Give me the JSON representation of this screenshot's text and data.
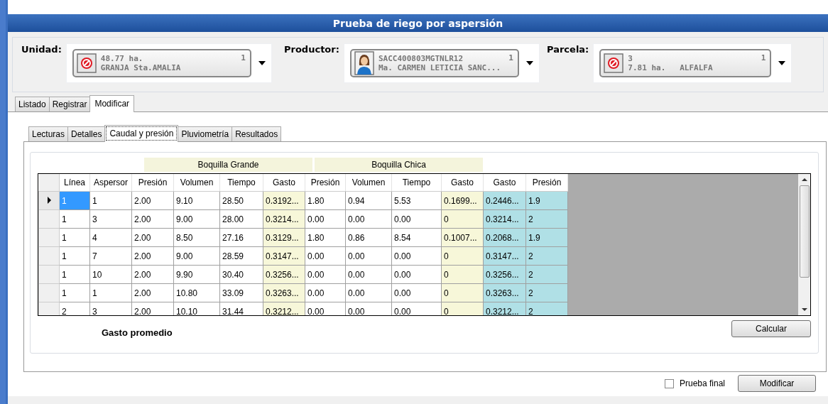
{
  "window": {
    "title": "Prueba de riego por aspersión"
  },
  "selectors": [
    {
      "label": "Unidad:",
      "kind": "blocked",
      "line1": "48.77 ha.",
      "line2": "GRANJA Sta.AMALIA",
      "count": "1"
    },
    {
      "label": "Productor:",
      "kind": "person",
      "line1": "SACC400803MGTNLR12",
      "line2": "Ma. CARMEN LETICIA SANC...",
      "count": "1"
    },
    {
      "label": "Parcela:",
      "kind": "blocked",
      "line1": "3",
      "line2": "7.81 ha.   ALFALFA",
      "count": "1"
    }
  ],
  "tabs": [
    {
      "label": "Listado",
      "selected": false
    },
    {
      "label": "Registrar",
      "selected": false
    },
    {
      "label": "Modificar",
      "selected": true
    }
  ],
  "subtabs": [
    {
      "label": "Lecturas",
      "selected": false
    },
    {
      "label": "Detalles",
      "selected": false
    },
    {
      "label": "Caudal y presión",
      "selected": true
    },
    {
      "label": "Pluviometría",
      "selected": false
    },
    {
      "label": "Resultados",
      "selected": false
    }
  ],
  "groups": [
    "Boquilla Grande",
    "Boquilla Chica"
  ],
  "table": {
    "columns": [
      {
        "label": "Línea",
        "kind": "plain"
      },
      {
        "label": "Aspersor",
        "kind": "plain"
      },
      {
        "label": "Presión",
        "kind": "plain"
      },
      {
        "label": "Volumen",
        "kind": "plain"
      },
      {
        "label": "Tiempo",
        "kind": "plain"
      },
      {
        "label": "Gasto",
        "kind": "yellow"
      },
      {
        "label": "Presión",
        "kind": "plain"
      },
      {
        "label": "Volumen",
        "kind": "plain"
      },
      {
        "label": "Tiempo",
        "kind": "plain"
      },
      {
        "label": "Gasto",
        "kind": "yellow"
      },
      {
        "label": "Gasto",
        "kind": "cyan"
      },
      {
        "label": "Presión",
        "kind": "cyan"
      }
    ],
    "rows": [
      {
        "selected": true,
        "cells": [
          "1",
          "1",
          "2.00",
          "9.10",
          "28.50",
          "0.3192...",
          "1.80",
          "0.94",
          "5.53",
          "0.1699...",
          "0.2446...",
          "1.9"
        ]
      },
      {
        "selected": false,
        "cells": [
          "1",
          "3",
          "2.00",
          "9.00",
          "28.00",
          "0.3214...",
          "0.00",
          "0.00",
          "0.00",
          "0",
          "0.3214...",
          "2"
        ]
      },
      {
        "selected": false,
        "cells": [
          "1",
          "4",
          "2.00",
          "8.50",
          "27.16",
          "0.3129...",
          "1.80",
          "0.86",
          "8.54",
          "0.1007...",
          "0.2068...",
          "1.9"
        ]
      },
      {
        "selected": false,
        "cells": [
          "1",
          "7",
          "2.00",
          "9.00",
          "28.59",
          "0.3147...",
          "0.00",
          "0.00",
          "0.00",
          "0",
          "0.3147...",
          "2"
        ]
      },
      {
        "selected": false,
        "cells": [
          "1",
          "10",
          "2.00",
          "9.90",
          "30.40",
          "0.3256...",
          "0.00",
          "0.00",
          "0.00",
          "0",
          "0.3256...",
          "2"
        ]
      },
      {
        "selected": false,
        "cells": [
          "1",
          "1",
          "2.00",
          "10.80",
          "33.09",
          "0.3263...",
          "0.00",
          "0.00",
          "0.00",
          "0",
          "0.3263...",
          "2"
        ]
      },
      {
        "selected": false,
        "cells": [
          "2",
          "3",
          "2.00",
          "10.10",
          "31.44",
          "0.3212...",
          "0.00",
          "0.00",
          "0.00",
          "0",
          "0.3212...",
          "2"
        ]
      }
    ]
  },
  "summary_title": "Gasto promedio",
  "calculate_button": "Calcular",
  "final_test": {
    "label": "Prueba final",
    "checked": false
  },
  "modify_button": "Modificar"
}
